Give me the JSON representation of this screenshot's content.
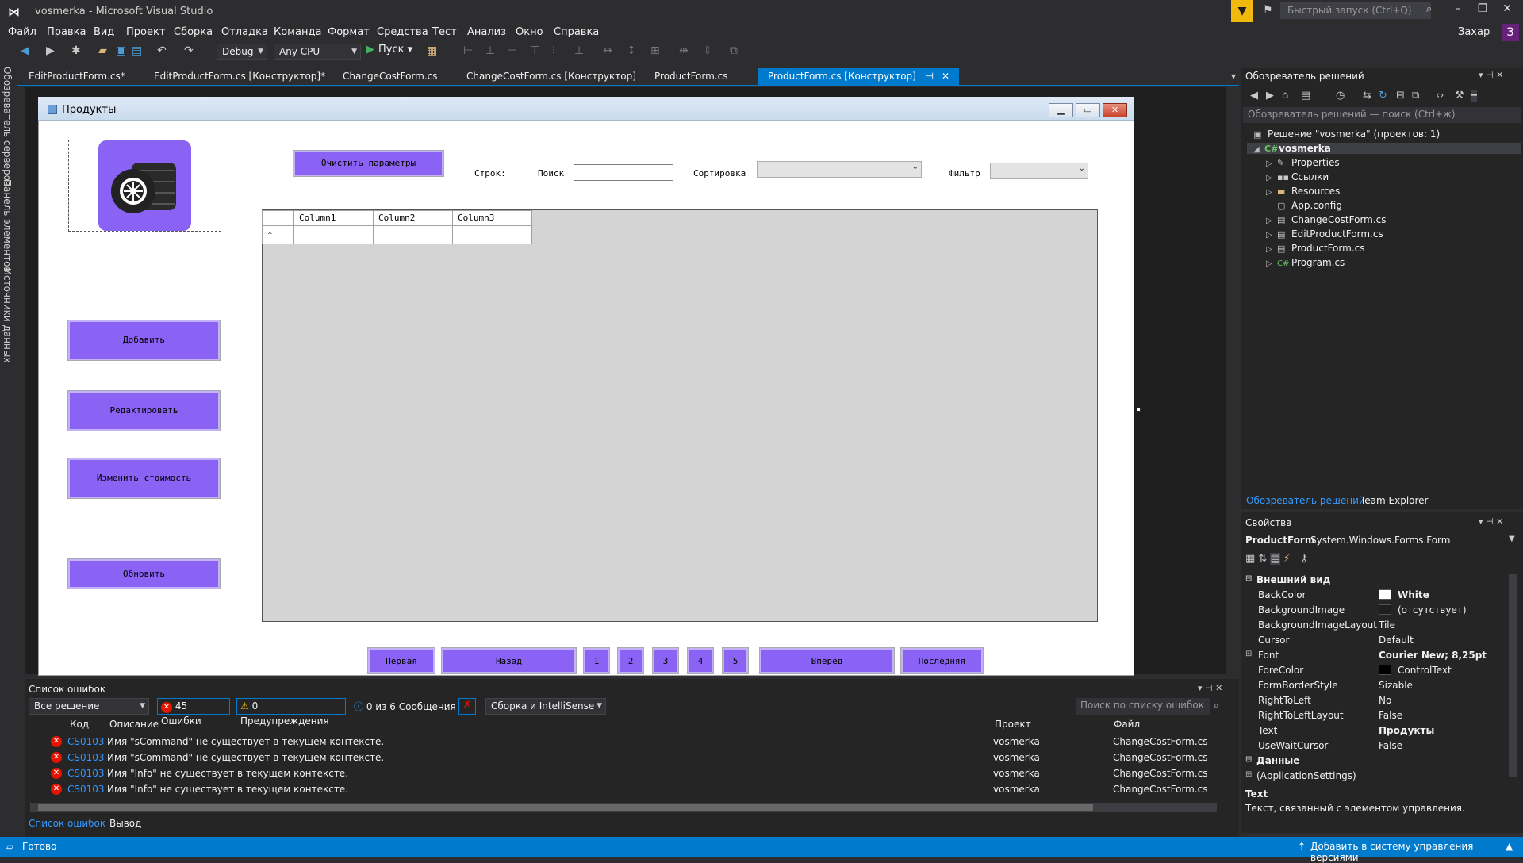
{
  "window": {
    "title": "vosmerka - Microsoft Visual Studio",
    "quick_launch_placeholder": "Быстрый запуск (Ctrl+Q)",
    "user": "Захар",
    "user_badge": "З"
  },
  "menu": [
    "Файл",
    "Правка",
    "Вид",
    "Проект",
    "Сборка",
    "Отладка",
    "Команда",
    "Формат",
    "Средства",
    "Тест",
    "Анализ",
    "Окно",
    "Справка"
  ],
  "toolbar": {
    "configuration": "Debug",
    "platform": "Any CPU",
    "run_label": "Пуск"
  },
  "left_strip": [
    "Обозреватель серверов",
    "Панель элементов",
    "Источники данных"
  ],
  "doc_tabs": [
    "EditProductForm.cs*",
    "EditProductForm.cs [Конструктор]*",
    "ChangeCostForm.cs",
    "ChangeCostForm.cs [Конструктор]",
    "ProductForm.cs",
    "ProductForm.cs [Конструктор]"
  ],
  "active_tab": 5,
  "form": {
    "title": "Продукты",
    "clear_button": "Очистить параметры",
    "rows_label": "Строк:",
    "search_label": "Поиск",
    "sort_label": "Сортировка",
    "filter_label": "Фильтр",
    "buttons": {
      "add": "Добавить",
      "edit": "Редактировать",
      "change_cost": "Изменить стоимость",
      "refresh": "Обновить"
    },
    "grid_columns": [
      "Column1",
      "Column2",
      "Column3"
    ],
    "grid_new_row_marker": "*",
    "pager": {
      "first": "Первая",
      "back": "Назад",
      "pages": [
        "1",
        "2",
        "3",
        "4",
        "5"
      ],
      "forward": "Вперёд",
      "last": "Последняя"
    }
  },
  "solution_explorer": {
    "header": "Обозреватель решений",
    "search_placeholder": "Обозреватель решений — поиск (Ctrl+ж)",
    "solution": "Решение \"vosmerka\"  (проектов: 1)",
    "project": "vosmerka",
    "items": [
      "Properties",
      "Ссылки",
      "Resources",
      "App.config",
      "ChangeCostForm.cs",
      "EditProductForm.cs",
      "ProductForm.cs",
      "Program.cs"
    ],
    "tabs": [
      "Обозреватель решений",
      "Team Explorer"
    ]
  },
  "properties": {
    "header": "Свойства",
    "object": "ProductForm",
    "object_type": "System.Windows.Forms.Form",
    "category_appearance": "Внешний вид",
    "rows": [
      {
        "name": "BackColor",
        "value": "White",
        "swatch": "#ffffff",
        "bold": true
      },
      {
        "name": "BackgroundImage",
        "value": "(отсутствует)",
        "swatch": "#1e1e1e",
        "bold": false
      },
      {
        "name": "BackgroundImageLayout",
        "value": "Tile",
        "bold": false
      },
      {
        "name": "Cursor",
        "value": "Default",
        "bold": false
      },
      {
        "name": "Font",
        "value": "Courier New; 8,25pt",
        "bold": true,
        "expand": true
      },
      {
        "name": "ForeColor",
        "value": "ControlText",
        "swatch": "#000000",
        "bold": false
      },
      {
        "name": "FormBorderStyle",
        "value": "Sizable",
        "bold": false
      },
      {
        "name": "RightToLeft",
        "value": "No",
        "bold": false
      },
      {
        "name": "RightToLeftLayout",
        "value": "False",
        "bold": false
      },
      {
        "name": "Text",
        "value": "Продукты",
        "bold": true
      },
      {
        "name": "UseWaitCursor",
        "value": "False",
        "bold": false
      }
    ],
    "category_data": "Данные",
    "app_settings": "(ApplicationSettings)",
    "desc_title": "Text",
    "desc_text": "Текст, связанный с элементом управления."
  },
  "error_list": {
    "header": "Список ошибок",
    "scope": "Все решение",
    "errors_btn": "45 Ошибки",
    "warnings_btn": "0 Предупреждения",
    "messages_btn": "0 из 6 Сообщения",
    "build_filter": "Сборка и IntelliSense",
    "search_placeholder": "Поиск по списку ошибок",
    "columns": {
      "code": "Код",
      "desc": "Описание",
      "project": "Проект",
      "file": "Файл"
    },
    "rows": [
      {
        "code": "CS0103",
        "desc": "Имя \"sCommand\" не существует в текущем контексте.",
        "project": "vosmerka",
        "file": "ChangeCostForm.cs"
      },
      {
        "code": "CS0103",
        "desc": "Имя \"sCommand\" не существует в текущем контексте.",
        "project": "vosmerka",
        "file": "ChangeCostForm.cs"
      },
      {
        "code": "CS0103",
        "desc": "Имя \"Info\" не существует в текущем контексте.",
        "project": "vosmerka",
        "file": "ChangeCostForm.cs"
      },
      {
        "code": "CS0103",
        "desc": "Имя \"Info\" не существует в текущем контексте.",
        "project": "vosmerka",
        "file": "ChangeCostForm.cs"
      }
    ],
    "tabs": [
      "Список ошибок",
      "Вывод"
    ]
  },
  "status": {
    "left": "Готово",
    "right": "Добавить в систему управления версиями"
  },
  "colors": {
    "accent": "#007acc",
    "form_button": "#8a63f5",
    "vs_purple": "#68217a"
  }
}
